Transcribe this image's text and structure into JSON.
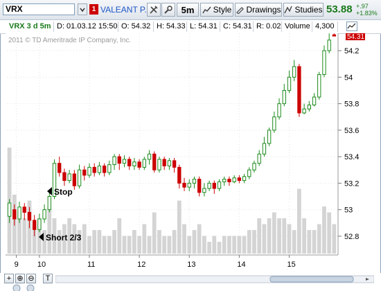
{
  "toolbar": {
    "symbol": "VRX",
    "badge": "1",
    "company": "VALEANT P...",
    "timeframe": "5m",
    "style_label": "Style",
    "drawings_label": "Drawings",
    "studies_label": "Studies",
    "last_price": "53.88",
    "change_abs": "+.97",
    "change_pct": "+1.83%",
    "price_color": "#1a7a1a"
  },
  "info": {
    "chart_symbol": "VRX 3 d 5m",
    "date": "D: 01.03.12 15:50",
    "open": "O: 54.32",
    "high": "H: 54.33",
    "low": "L: 54.31",
    "close": "C: 54.31",
    "range": "R: 0.02",
    "volume_label": "Volume",
    "volume": "4,300"
  },
  "chart": {
    "watermark": "2011 © TD Ameritrade IP Company, Inc.",
    "price_tag": "54.31",
    "y_ticks": [
      "54.2",
      "54",
      "53.8",
      "53.6",
      "53.4",
      "53.2",
      "53",
      "52.8"
    ],
    "x_ticks": [
      "9",
      "10",
      "11",
      "12",
      "13",
      "14",
      "15"
    ],
    "annotations": [
      "Stop",
      "Short 2/3"
    ],
    "up_color": "#1a8a1a",
    "down_color": "#cc0000",
    "volume_color": "#d4d4d4"
  },
  "chart_data": {
    "type": "candlestick",
    "ylim": [
      52.7,
      54.3
    ],
    "x_tick_labels": [
      "9",
      "10",
      "11",
      "12",
      "13",
      "14",
      "15"
    ],
    "candles": [
      [
        52.95,
        53.05,
        52.9,
        53.08
      ],
      [
        53.0,
        52.93,
        52.88,
        53.04
      ],
      [
        52.93,
        53.02,
        52.9,
        53.06
      ],
      [
        53.02,
        52.98,
        52.92,
        53.05
      ],
      [
        52.98,
        52.92,
        52.86,
        53.02
      ],
      [
        52.92,
        52.85,
        52.8,
        52.96
      ],
      [
        52.85,
        52.93,
        52.83,
        52.97
      ],
      [
        52.93,
        53.0,
        52.9,
        53.04
      ],
      [
        53.0,
        53.1,
        52.98,
        53.14
      ],
      [
        53.1,
        53.35,
        53.08,
        53.38
      ],
      [
        53.35,
        53.28,
        53.25,
        53.4
      ],
      [
        53.28,
        53.22,
        53.18,
        53.31
      ],
      [
        53.22,
        53.27,
        53.2,
        53.3
      ],
      [
        53.27,
        53.18,
        53.15,
        53.3
      ],
      [
        53.18,
        53.3,
        53.16,
        53.34
      ],
      [
        53.3,
        53.26,
        53.22,
        53.33
      ],
      [
        53.26,
        53.32,
        53.24,
        53.35
      ],
      [
        53.32,
        53.28,
        53.25,
        53.35
      ],
      [
        53.28,
        53.33,
        53.26,
        53.36
      ],
      [
        53.33,
        53.28,
        53.25,
        53.35
      ],
      [
        53.28,
        53.34,
        53.26,
        53.37
      ],
      [
        53.34,
        53.4,
        53.3,
        53.42
      ],
      [
        53.4,
        53.35,
        53.3,
        53.42
      ],
      [
        53.35,
        53.38,
        53.32,
        53.41
      ],
      [
        53.38,
        53.33,
        53.3,
        53.4
      ],
      [
        53.33,
        53.36,
        53.3,
        53.39
      ],
      [
        53.36,
        53.32,
        53.3,
        53.38
      ],
      [
        53.32,
        53.38,
        53.3,
        53.4
      ],
      [
        53.38,
        53.42,
        53.34,
        53.45
      ],
      [
        53.42,
        53.3,
        53.28,
        53.44
      ],
      [
        53.3,
        53.38,
        53.28,
        53.4
      ],
      [
        53.38,
        53.33,
        53.3,
        53.4
      ],
      [
        53.33,
        53.37,
        53.3,
        53.39
      ],
      [
        53.37,
        53.32,
        53.28,
        53.39
      ],
      [
        53.32,
        53.2,
        53.16,
        53.34
      ],
      [
        53.2,
        53.17,
        53.14,
        53.24
      ],
      [
        53.17,
        53.2,
        53.14,
        53.23
      ],
      [
        53.2,
        53.23,
        53.16,
        53.25
      ],
      [
        53.23,
        53.13,
        53.1,
        53.25
      ],
      [
        53.13,
        53.16,
        53.1,
        53.2
      ],
      [
        53.16,
        53.2,
        53.14,
        53.22
      ],
      [
        53.2,
        53.16,
        53.12,
        53.22
      ],
      [
        53.16,
        53.21,
        53.14,
        53.23
      ],
      [
        53.21,
        53.23,
        53.18,
        53.25
      ],
      [
        53.23,
        53.21,
        53.18,
        53.25
      ],
      [
        53.21,
        53.24,
        53.2,
        53.26
      ],
      [
        53.24,
        53.22,
        53.2,
        53.26
      ],
      [
        53.22,
        53.25,
        53.2,
        53.27
      ],
      [
        53.25,
        53.3,
        53.23,
        53.32
      ],
      [
        53.3,
        53.35,
        53.28,
        53.37
      ],
      [
        53.35,
        53.42,
        53.33,
        53.45
      ],
      [
        53.42,
        53.5,
        53.4,
        53.55
      ],
      [
        53.5,
        53.6,
        53.48,
        53.62
      ],
      [
        53.6,
        53.7,
        53.58,
        53.74
      ],
      [
        53.7,
        53.8,
        53.68,
        53.84
      ],
      [
        53.8,
        53.9,
        53.78,
        53.95
      ],
      [
        53.9,
        54.0,
        53.88,
        54.05
      ],
      [
        54.0,
        54.08,
        53.97,
        54.13
      ],
      [
        54.08,
        53.73,
        53.7,
        54.1
      ],
      [
        53.73,
        53.76,
        53.72,
        53.8
      ],
      [
        53.76,
        53.79,
        53.74,
        53.82
      ],
      [
        53.79,
        53.85,
        53.78,
        53.88
      ],
      [
        53.85,
        54.02,
        53.83,
        54.04
      ],
      [
        54.02,
        54.2,
        54.0,
        54.24
      ],
      [
        54.2,
        54.28,
        54.18,
        54.33
      ],
      [
        54.32,
        54.31,
        54.31,
        54.33
      ]
    ],
    "volume_relative": [
      0.9,
      0.5,
      0.35,
      0.3,
      0.45,
      0.25,
      0.3,
      0.2,
      0.4,
      0.3,
      0.2,
      0.25,
      0.3,
      0.25,
      0.2,
      0.25,
      0.15,
      0.2,
      0.2,
      0.15,
      0.15,
      0.2,
      0.3,
      0.15,
      0.15,
      0.2,
      0.15,
      0.25,
      0.15,
      0.35,
      0.2,
      0.15,
      0.15,
      0.2,
      0.45,
      0.25,
      0.15,
      0.2,
      0.25,
      0.15,
      0.1,
      0.15,
      0.1,
      0.15,
      0.15,
      0.15,
      0.15,
      0.15,
      0.2,
      0.2,
      0.3,
      0.25,
      0.3,
      0.35,
      0.3,
      0.3,
      0.25,
      0.2,
      0.55,
      0.3,
      0.2,
      0.2,
      0.25,
      0.4,
      0.35,
      0.25
    ]
  }
}
